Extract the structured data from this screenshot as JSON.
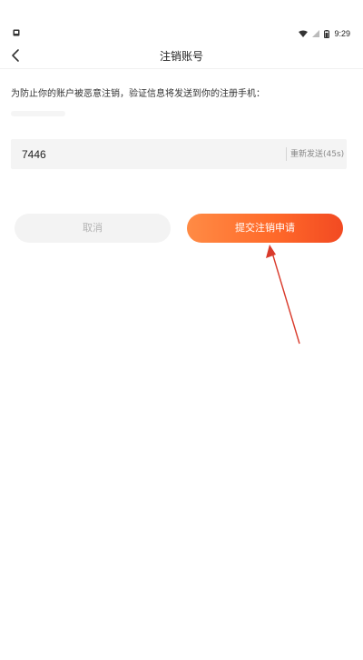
{
  "status_bar": {
    "time": "9:29",
    "icons": [
      "notification-icon",
      "wifi-icon",
      "signal-icon",
      "battery-icon"
    ]
  },
  "nav": {
    "back_icon": "chevron-left-icon",
    "title": "注销账号"
  },
  "notice": {
    "text": "为防止你的账户被恶意注销，验证信息将发送到你的注册手机："
  },
  "code_input": {
    "value": "7446",
    "resend_label": "重新发送(45s)"
  },
  "buttons": {
    "cancel_label": "取消",
    "submit_label": "提交注销申请"
  },
  "colors": {
    "accent_start": "#ff8b45",
    "accent_end": "#f24a22",
    "annotation": "#d93a2b"
  }
}
